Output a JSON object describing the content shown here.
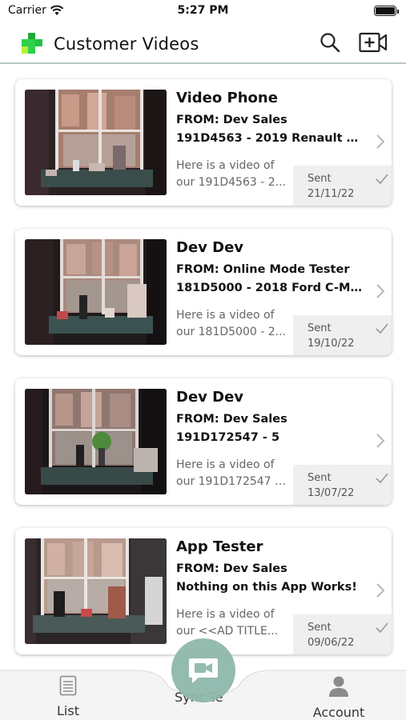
{
  "status_bar": {
    "carrier": "Carrier",
    "time": "5:27 PM"
  },
  "header": {
    "title": "Customer Videos",
    "brand_color": "#2fd04a"
  },
  "videos": [
    {
      "name": "Video Phone",
      "from": "FROM: Dev Sales",
      "vehicle": "191D4563 - 2019 Renault KA...",
      "message_line1": "Here is a video of",
      "message_line2": "our 191D4563 - 2...",
      "status": "Sent",
      "date": "21/11/22"
    },
    {
      "name": "Dev Dev",
      "from": "FROM: Online Mode Tester",
      "vehicle": "181D5000 - 2018 Ford C-MA...",
      "message_line1": "Here is a video of",
      "message_line2": "our 181D5000 - 2...",
      "status": "Sent",
      "date": "19/10/22"
    },
    {
      "name": "Dev Dev",
      "from": "FROM: Dev Sales",
      "vehicle": "191D172547 - 5",
      "message_line1": "Here is a video of",
      "message_line2": "our 191D172547 -...",
      "status": "Sent",
      "date": "13/07/22"
    },
    {
      "name": "App Tester",
      "from": "FROM: Dev Sales",
      "vehicle": "Nothing on this App Works!",
      "message_line1": "Here is a video of",
      "message_line2": "our <<AD TITLE...",
      "status": "Sent",
      "date": "09/06/22"
    }
  ],
  "tab_bar": {
    "list_label": "List",
    "sync_label": "Sync Te",
    "account_label": "Account",
    "fab_color": "#8fb8ab"
  }
}
